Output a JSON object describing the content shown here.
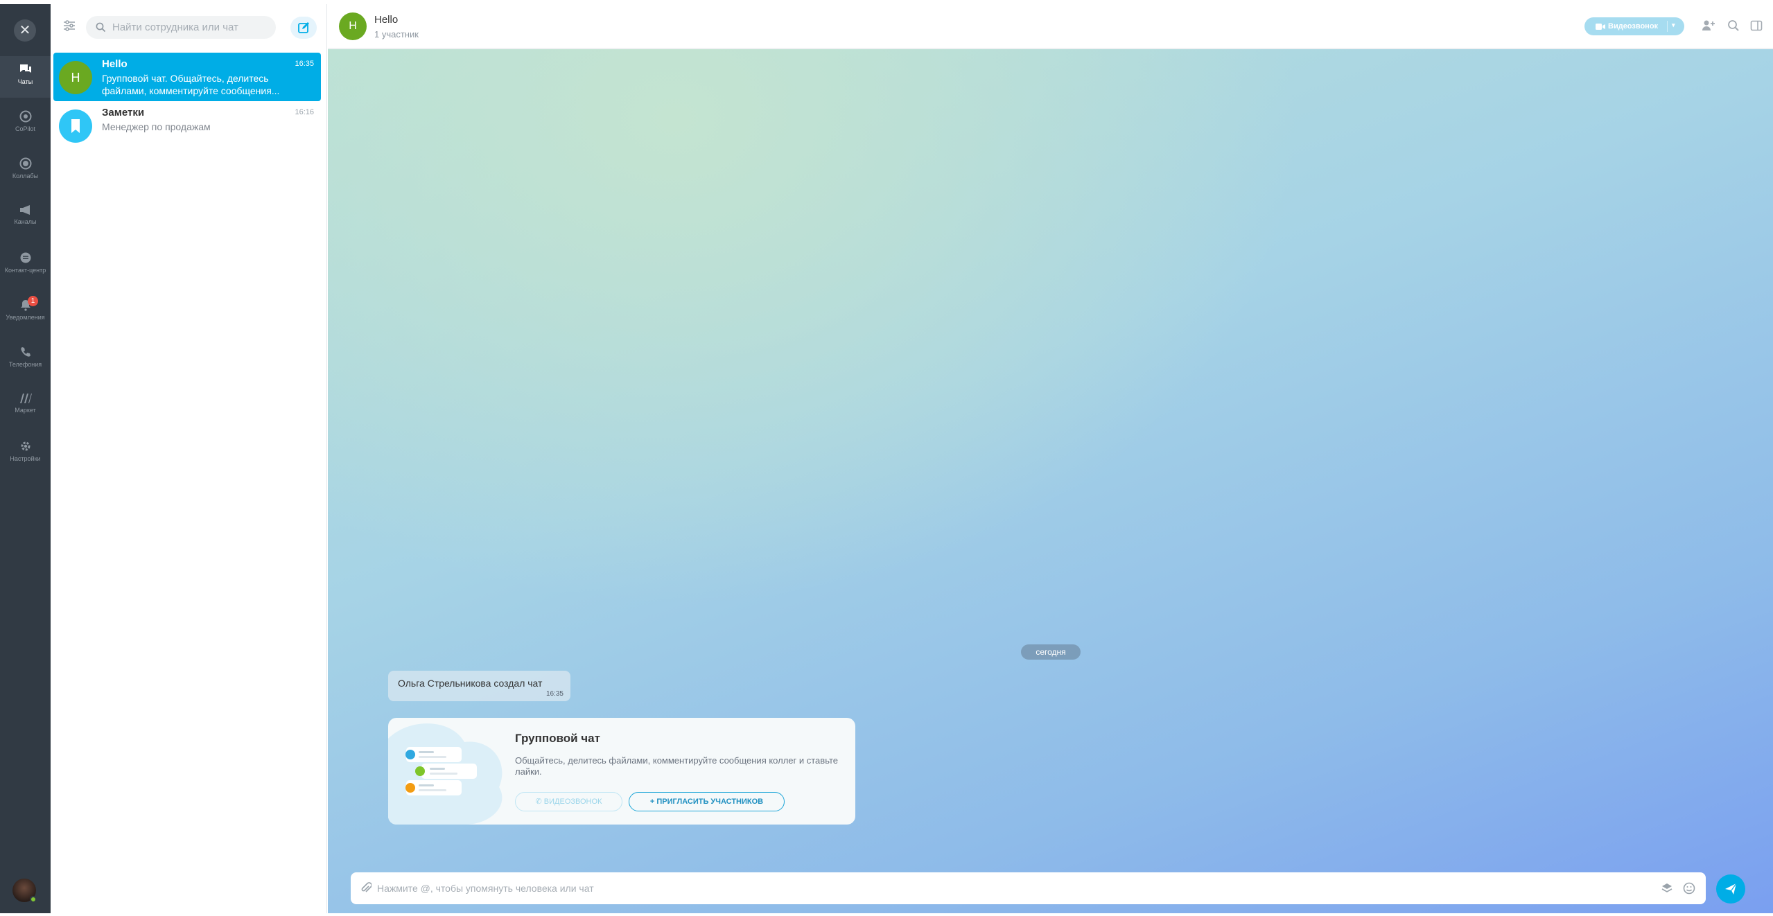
{
  "rail": {
    "close_glyph": "✕",
    "items": [
      {
        "label": "Чаты",
        "icon": "chat-bubbles-icon"
      },
      {
        "label": "CoPilot",
        "icon": "copilot-icon"
      },
      {
        "label": "Коллабы",
        "icon": "collab-icon"
      },
      {
        "label": "Каналы",
        "icon": "megaphone-icon"
      },
      {
        "label": "Контакт-центр",
        "icon": "contact-center-icon"
      },
      {
        "label": "Уведомления",
        "icon": "bell-icon",
        "badge": "1"
      },
      {
        "label": "Телефония",
        "icon": "phone-icon"
      },
      {
        "label": "Маркет",
        "icon": "market-icon"
      },
      {
        "label": "Настройки",
        "icon": "gear-icon"
      }
    ]
  },
  "list": {
    "search_placeholder": "Найти сотрудника или чат",
    "chats": [
      {
        "avatar_letter": "H",
        "avatar_color": "#6aa921",
        "title": "Hello",
        "time": "16:35",
        "preview": "Групповой чат. Общайтесь, делитесь файлами, комментируйте сообщения..."
      },
      {
        "title": "Заметки",
        "time": "16:16",
        "preview": "Менеджер по продажам",
        "avatar_color": "#2fc6f6",
        "avatar_icon": "bookmark-icon"
      }
    ]
  },
  "header": {
    "avatar_letter": "H",
    "title": "Hello",
    "subtitle": "1 участник",
    "video_call": "Видеозвонок"
  },
  "messages": {
    "date_pill": "сегодня",
    "system_text": "Ольга Стрельникова создал чат",
    "system_time": "16:35"
  },
  "card": {
    "title": "Групповой чат",
    "text": "Общайтесь, делитесь файлами, комментируйте сообщения коллег и ставьте лайки.",
    "video_button": "ВИДЕОЗВОНОК",
    "invite_button": "ПРИГЛАСИТЬ УЧАСТНИКОВ"
  },
  "composer": {
    "placeholder": "Нажмите @, чтобы упомянуть человека или чат"
  },
  "colors": {
    "accent": "#00ade6",
    "rail": "#313a44",
    "avatar_green": "#6aa921",
    "notes_blue": "#2fc6f6",
    "badge_red": "#ea4f43"
  }
}
